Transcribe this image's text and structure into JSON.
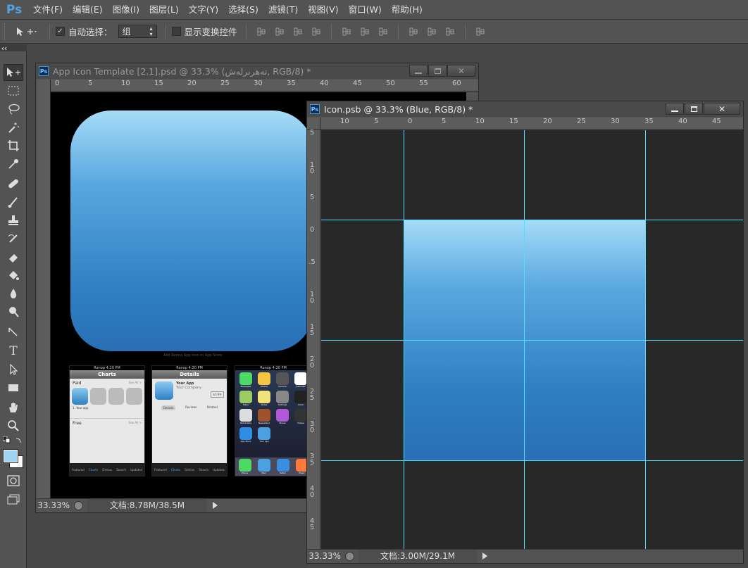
{
  "app": {
    "logo": "Ps"
  },
  "menu": [
    {
      "label": "文件(F)"
    },
    {
      "label": "编辑(E)"
    },
    {
      "label": "图像(I)"
    },
    {
      "label": "图层(L)"
    },
    {
      "label": "文字(Y)"
    },
    {
      "label": "选择(S)"
    },
    {
      "label": "滤镜(T)"
    },
    {
      "label": "视图(V)"
    },
    {
      "label": "窗口(W)"
    },
    {
      "label": "帮助(H)"
    }
  ],
  "options": {
    "auto_select_label": "自动选择：",
    "auto_select_checked": true,
    "auto_select_value": "组",
    "show_transform_label": "显示变换控件",
    "show_transform_checked": false
  },
  "tools": [
    {
      "icon": "move-tool-icon"
    },
    {
      "icon": "marquee-tool-icon"
    },
    {
      "icon": "lasso-tool-icon"
    },
    {
      "icon": "magic-wand-tool-icon"
    },
    {
      "icon": "crop-tool-icon"
    },
    {
      "icon": "eyedropper-tool-icon"
    },
    {
      "icon": "healing-brush-tool-icon"
    },
    {
      "icon": "brush-tool-icon"
    },
    {
      "icon": "clone-stamp-tool-icon"
    },
    {
      "icon": "history-brush-tool-icon"
    },
    {
      "icon": "eraser-tool-icon"
    },
    {
      "icon": "paint-bucket-tool-icon"
    },
    {
      "icon": "blur-tool-icon"
    },
    {
      "icon": "dodge-tool-icon"
    },
    {
      "icon": "pen-tool-icon"
    },
    {
      "icon": "type-tool-icon"
    },
    {
      "icon": "path-selection-tool-icon"
    },
    {
      "icon": "rectangle-tool-icon"
    },
    {
      "icon": "hand-tool-icon"
    },
    {
      "icon": "zoom-tool-icon"
    }
  ],
  "colors": {
    "foreground": "#9fd3f2",
    "background": "#ffffff",
    "guide": "#4de0ff",
    "icon_top": "#a6dcf8",
    "icon_bottom": "#2a6fb5"
  },
  "doc1": {
    "title": "App Icon Template [2.1].psd @ 33.3% (تەھرىرلەش, RGB/8) *",
    "zoom": "33.33%",
    "status": "文档:8.78M/38.5M",
    "ruler_h": [
      "0",
      "5",
      "10",
      "15",
      "20",
      "25",
      "30",
      "35",
      "40",
      "45",
      "50",
      "55",
      "60"
    ],
    "caption": "Add Retina App Icon to App Store",
    "screens": {
      "charts": {
        "carrier": "Ranop",
        "time": "4:20 PM",
        "title": "Charts",
        "back": "Categories",
        "paid": "Paid",
        "see_all": "See All >",
        "free": "Free",
        "app_name": "1. Your app",
        "app_company": "Company"
      },
      "details": {
        "carrier": "Ranop",
        "time": "4:20 PM",
        "title": "Details",
        "back": "Charts",
        "app_name": "Your App",
        "company": "Your Company",
        "price": "$0.99",
        "seg": [
          "Details",
          "Reviews",
          "Related"
        ]
      },
      "home": {
        "carrier": "Ranop",
        "time": "4:20 PM",
        "apps": [
          "Messages",
          "Photos",
          "Camera",
          "Calendar",
          "Maps",
          "Notes",
          "Settings",
          "Clock",
          "Reminders",
          "Newsstand",
          "iTunes",
          "Videos",
          "App Store",
          "Your App"
        ],
        "dock": [
          "Phone",
          "Mail",
          "Safari",
          "Music"
        ],
        "calendar_day": "17"
      },
      "tabs": [
        "Featured",
        "Charts",
        "Genius",
        "Search",
        "Updates"
      ]
    }
  },
  "doc2": {
    "title": "Icon.psb @ 33.3% (Blue, RGB/8) *",
    "zoom": "33.33%",
    "status": "文档:3.00M/29.1M",
    "ruler_h": [
      "10",
      "5",
      "0",
      "5",
      "10",
      "15",
      "20",
      "25",
      "30",
      "35",
      "40",
      "45"
    ],
    "ruler_v": [
      "5",
      "1\n0",
      "5",
      "0",
      ".5",
      "1\n0",
      "1\n5",
      "2\n0",
      "2\n5",
      "3\n0",
      "3\n5",
      "4\n0",
      "4\n5"
    ]
  }
}
